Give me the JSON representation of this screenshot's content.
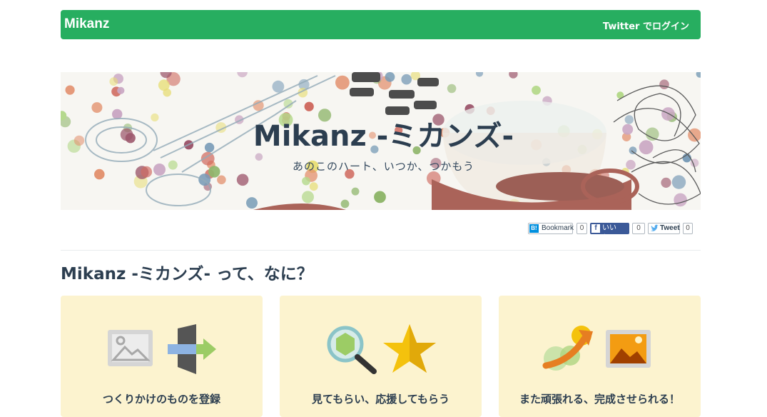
{
  "navbar": {
    "brand": "Mikanz",
    "login_label": "Twitter でログイン"
  },
  "hero": {
    "title": "Mikanz -ミカンズ-",
    "subtitle": "あのこのハート、いつか、つかもう"
  },
  "social": {
    "hatena": {
      "icon_label": "B!",
      "label": "Bookmark",
      "count": "0"
    },
    "facebook": {
      "icon_label": "f",
      "label": "いいね！",
      "count": "0"
    },
    "twitter": {
      "label": "Tweet",
      "count": "0"
    }
  },
  "section": {
    "title": "Mikanz -ミカンズ- って、なに？"
  },
  "cards": [
    {
      "label": "つくりかけのものを登録",
      "icons": [
        "image-icon",
        "import-arrow-icon"
      ]
    },
    {
      "label": "見てもらい、応援してもらう",
      "icons": [
        "magnifier-icon",
        "star-icon"
      ]
    },
    {
      "label": "また頑張れる、完成させられる！",
      "icons": [
        "rising-arrow-icon",
        "picture-icon"
      ]
    }
  ],
  "colors": {
    "navbar": "#27ae60",
    "text": "#2c3e50",
    "card_bg": "#fcf3cf",
    "hatena": "#008fde",
    "facebook": "#3b5998",
    "twitter": "#55acee"
  }
}
